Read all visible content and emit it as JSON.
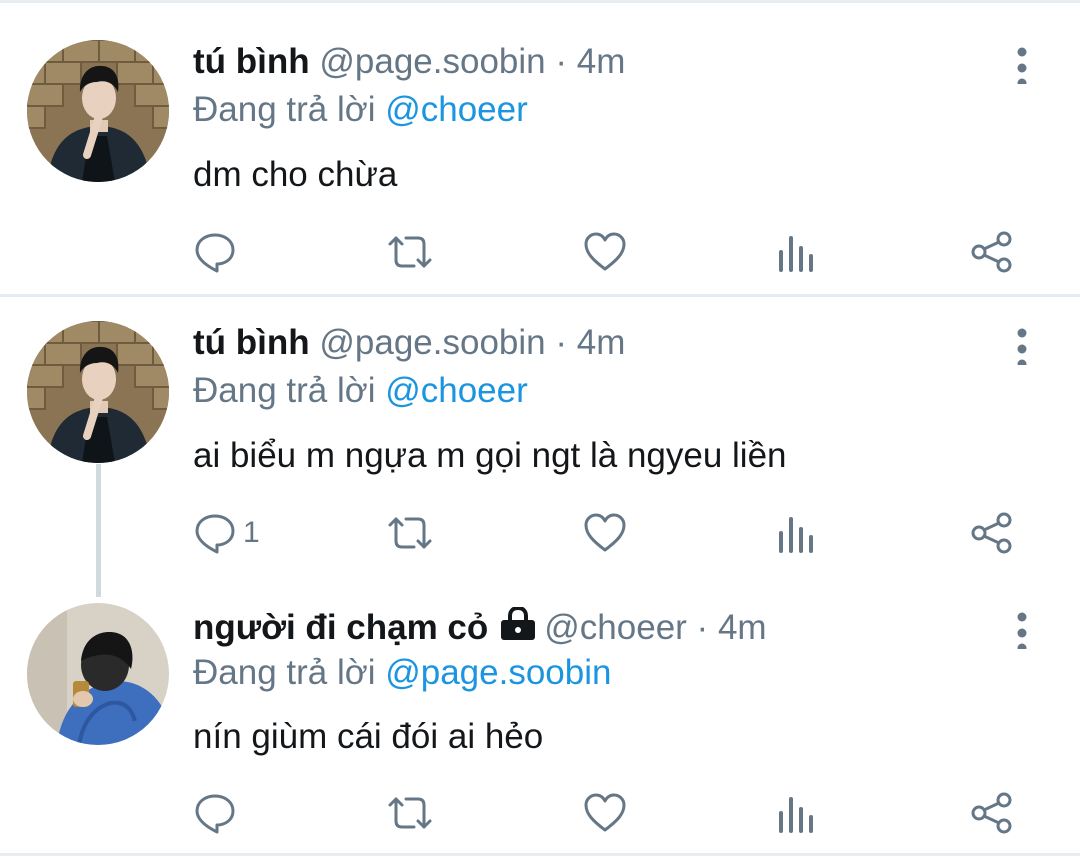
{
  "tweets": [
    {
      "name": "tú bình",
      "handle": "@page.soobin",
      "separator": "·",
      "time": "4m",
      "reply_prefix": "Đang trả lời",
      "reply_to": "@choeer",
      "text": "dm cho chừa",
      "reply_count": "",
      "avatar": "avatar-person-brick-wall",
      "locked": false
    },
    {
      "name": "tú bình",
      "handle": "@page.soobin",
      "separator": "·",
      "time": "4m",
      "reply_prefix": "Đang trả lời",
      "reply_to": "@choeer",
      "text": "ai biểu m ngựa m gọi ngt là ngyeu liền",
      "reply_count": "1",
      "avatar": "avatar-person-brick-wall",
      "locked": false
    },
    {
      "name": "người đi chạm cỏ",
      "handle": "@choeer",
      "separator": "·",
      "time": "4m",
      "reply_prefix": "Đang trả lời",
      "reply_to": "@page.soobin",
      "text": "nín giùm cái đói ai hẻo",
      "reply_count": "",
      "avatar": "avatar-person-blue-sweater",
      "locked": true
    }
  ],
  "icons": {
    "reply": "comment-bubble-icon",
    "retweet": "retweet-icon",
    "like": "heart-icon",
    "stats": "analytics-icon",
    "share": "share-icon",
    "more": "more-vertical-icon",
    "lock": "lock-icon"
  },
  "colors": {
    "text": "#14171a",
    "secondary": "#657786",
    "mention": "#1b95e0",
    "divider": "#e6ecf0",
    "thread_line": "#cfd9de"
  }
}
